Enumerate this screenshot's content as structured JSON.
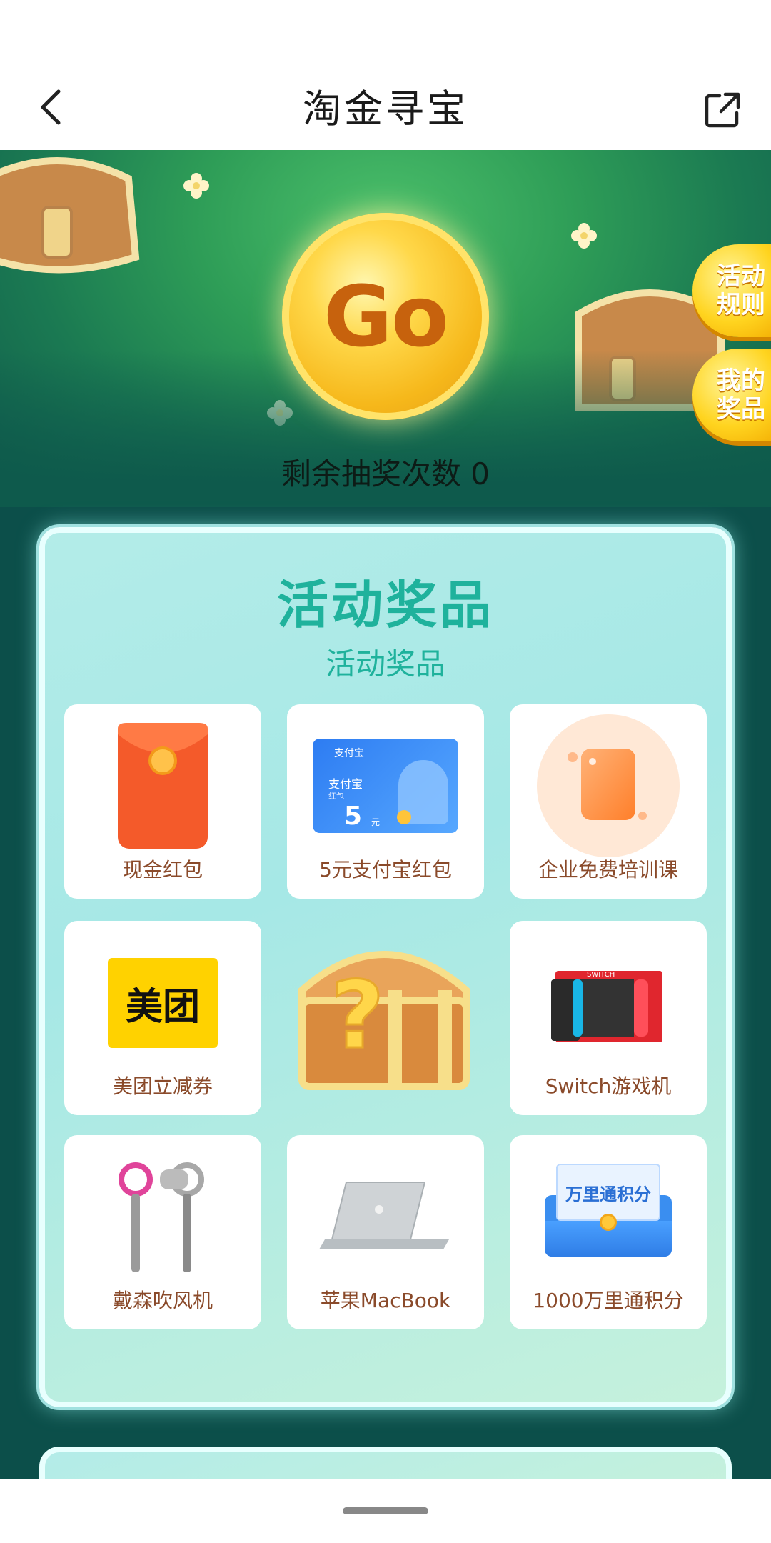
{
  "nav": {
    "title": "淘金寻宝"
  },
  "hero": {
    "go_label": "Go",
    "draws_left": "剩余抽奖次数 0",
    "rules_button": "活动规则",
    "my_prizes_button": "我的奖品"
  },
  "prizes": {
    "title": "活动奖品",
    "subtitle": "活动奖品",
    "items": [
      {
        "label": "现金红包",
        "icon": "red-envelope-icon"
      },
      {
        "label": "5元支付宝红包",
        "icon": "alipay-card-icon",
        "card_brand": "支付宝",
        "card_caption": "红包",
        "card_amount": "5",
        "card_unit": "元"
      },
      {
        "label": "企业免费培训课",
        "icon": "course-icon"
      },
      {
        "label": "美团立减券",
        "icon": "meituan-logo-icon",
        "logo_text": "美团"
      },
      {
        "label": "",
        "icon": "mystery-chest-icon"
      },
      {
        "label": "Switch游戏机",
        "icon": "switch-console-icon"
      },
      {
        "label": "戴森吹风机",
        "icon": "hair-dryer-icon"
      },
      {
        "label": "苹果MacBook",
        "icon": "laptop-icon"
      },
      {
        "label": "1000万里通积分",
        "icon": "points-envelope-icon",
        "envelope_text": "万里通积分"
      }
    ]
  },
  "colors": {
    "accent": "#1fb29c",
    "label": "#8a4a2a",
    "page_bg": "#0c4f4a"
  }
}
